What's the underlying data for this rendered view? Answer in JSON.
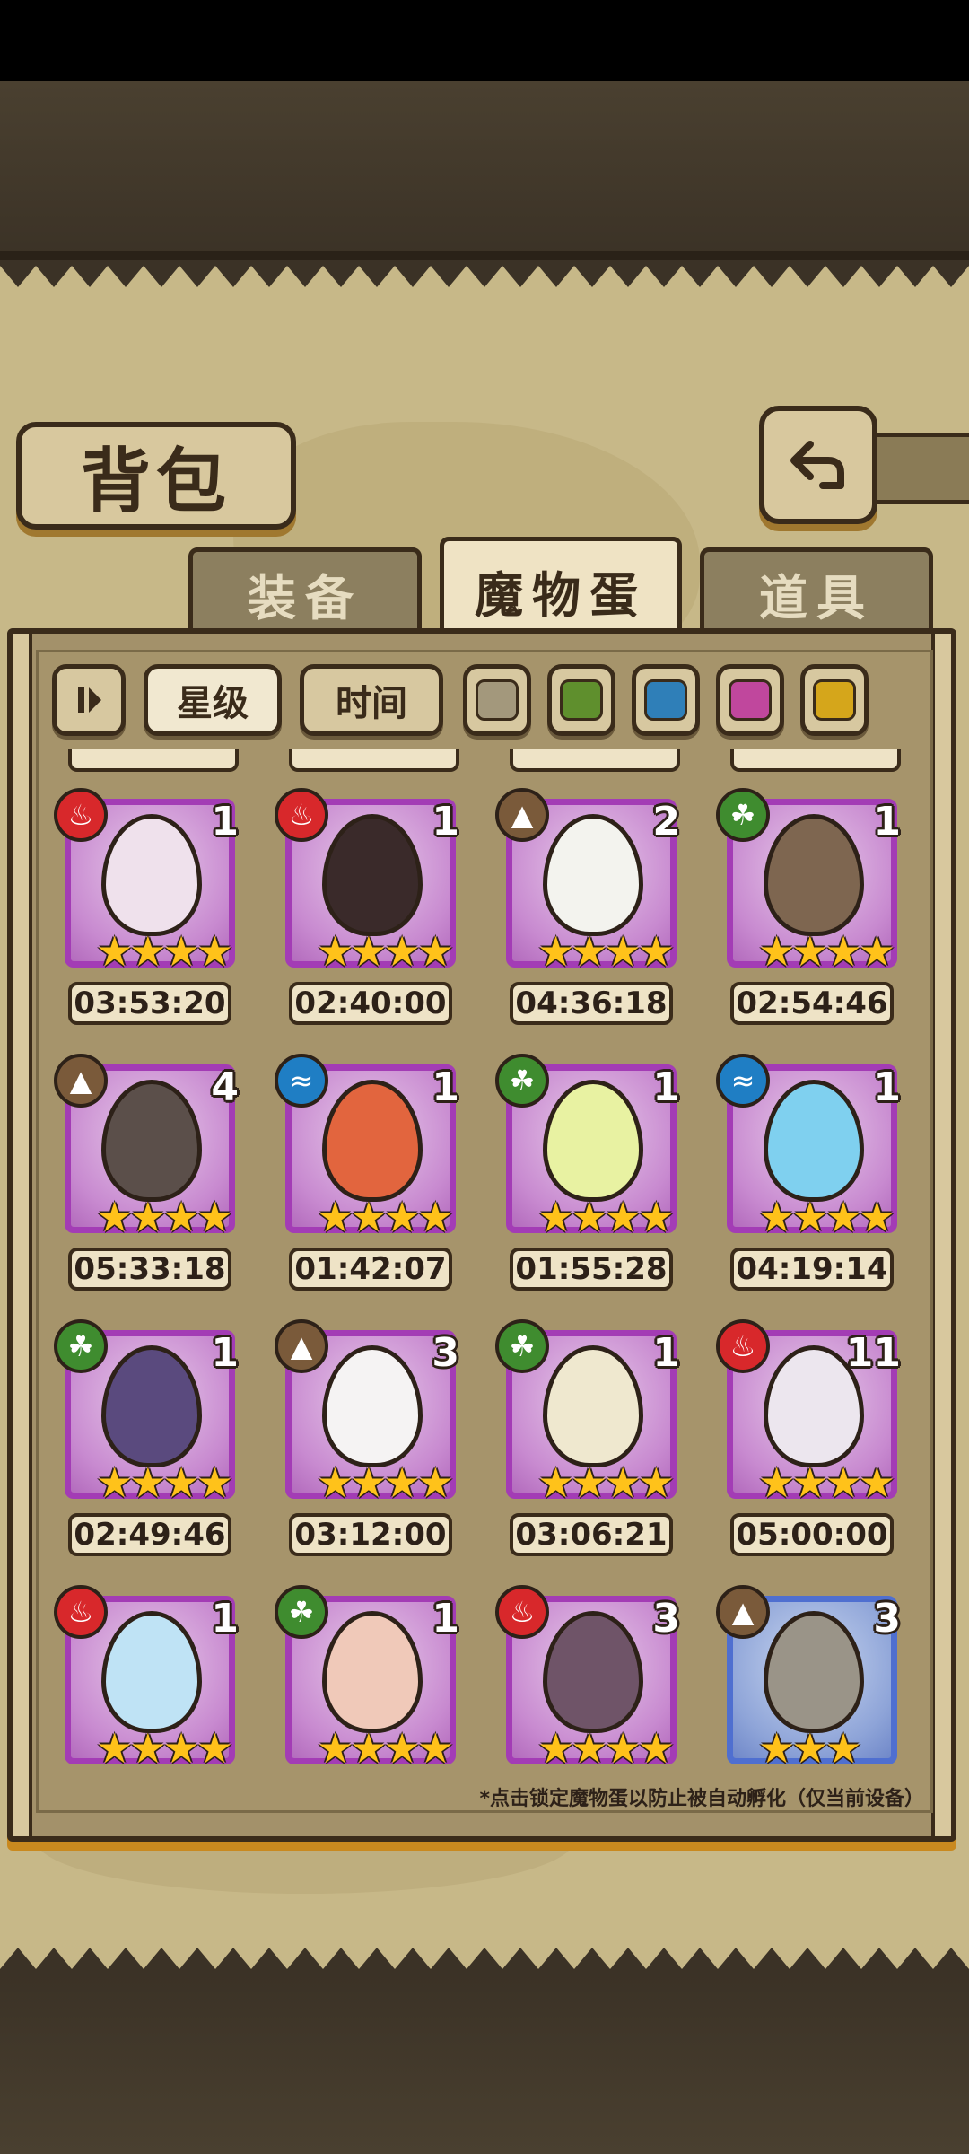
{
  "title": "背包",
  "tabs": [
    {
      "label": "装备",
      "active": false
    },
    {
      "label": "魔物蛋",
      "active": true
    },
    {
      "label": "道具",
      "active": false
    }
  ],
  "filters": {
    "sort_toggle_icon": "sort-toggle-icon",
    "sort_options": [
      {
        "label": "星级",
        "selected": true
      },
      {
        "label": "时间",
        "selected": false
      }
    ],
    "color_filters": [
      {
        "name": "grey",
        "color": "#a3987c"
      },
      {
        "name": "green",
        "color": "#5f8f2d"
      },
      {
        "name": "blue",
        "color": "#2f7fb8"
      },
      {
        "name": "pink",
        "color": "#c0479d"
      },
      {
        "name": "yellow",
        "color": "#d5a61b"
      }
    ]
  },
  "eggs": [
    {
      "element": "fire",
      "count": "1",
      "stars": 4,
      "timer": "03:53:20",
      "rarity": "purple",
      "egg_color": "#efe1ec"
    },
    {
      "element": "fire",
      "count": "1",
      "stars": 4,
      "timer": "02:40:00",
      "rarity": "purple",
      "egg_color": "#3a2a2a"
    },
    {
      "element": "earth",
      "count": "2",
      "stars": 4,
      "timer": "04:36:18",
      "rarity": "purple",
      "egg_color": "#f3f3ee"
    },
    {
      "element": "grass",
      "count": "1",
      "stars": 4,
      "timer": "02:54:46",
      "rarity": "purple",
      "egg_color": "#7e6650"
    },
    {
      "element": "earth",
      "count": "4",
      "stars": 4,
      "timer": "05:33:18",
      "rarity": "purple",
      "egg_color": "#5b4f4a"
    },
    {
      "element": "water",
      "count": "1",
      "stars": 4,
      "timer": "01:42:07",
      "rarity": "purple",
      "egg_color": "#e2653e"
    },
    {
      "element": "grass",
      "count": "1",
      "stars": 4,
      "timer": "01:55:28",
      "rarity": "purple",
      "egg_color": "#e8f2a2"
    },
    {
      "element": "water",
      "count": "1",
      "stars": 4,
      "timer": "04:19:14",
      "rarity": "purple",
      "egg_color": "#7fd0ef"
    },
    {
      "element": "grass",
      "count": "1",
      "stars": 4,
      "timer": "02:49:46",
      "rarity": "purple",
      "egg_color": "#5a4a7e"
    },
    {
      "element": "earth",
      "count": "3",
      "stars": 4,
      "timer": "03:12:00",
      "rarity": "purple",
      "egg_color": "#f5f3f3"
    },
    {
      "element": "grass",
      "count": "1",
      "stars": 4,
      "timer": "03:06:21",
      "rarity": "purple",
      "egg_color": "#efe8cf"
    },
    {
      "element": "fire",
      "count": "11",
      "stars": 4,
      "timer": "05:00:00",
      "rarity": "purple",
      "egg_color": "#ece6ee"
    },
    {
      "element": "fire",
      "count": "1",
      "stars": 4,
      "timer": "",
      "rarity": "purple",
      "egg_color": "#bfe3f5"
    },
    {
      "element": "grass",
      "count": "1",
      "stars": 4,
      "timer": "",
      "rarity": "purple",
      "egg_color": "#f0c9b9"
    },
    {
      "element": "fire",
      "count": "3",
      "stars": 4,
      "timer": "",
      "rarity": "purple",
      "egg_color": "#6f5468"
    },
    {
      "element": "earth",
      "count": "3",
      "stars": 3,
      "timer": "",
      "rarity": "blue",
      "egg_color": "#9a9488"
    }
  ],
  "element_colors": {
    "fire": "#d8282b",
    "earth": "#7a5a3a",
    "grass": "#3f8c2f",
    "water": "#1f7ec4"
  },
  "element_icons": {
    "fire": "fire-icon",
    "earth": "mountain-icon",
    "grass": "leaf-icon",
    "water": "wave-icon"
  },
  "notice": "*点击锁定魔物蛋以防止被自动孵化（仅当前设备）"
}
